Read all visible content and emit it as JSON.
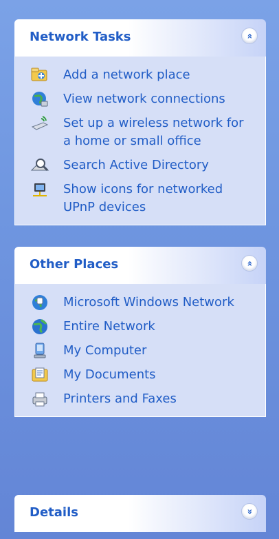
{
  "network_tasks": {
    "title": "Network Tasks",
    "collapse_glyph": "«",
    "items": [
      {
        "label": "Add a network place",
        "icon": "add-network-place-icon"
      },
      {
        "label": "View network connections",
        "icon": "network-connections-icon"
      },
      {
        "label": "Set up a wireless network for a home or small office",
        "icon": "wireless-network-icon"
      },
      {
        "label": "Search Active Directory",
        "icon": "search-directory-icon"
      },
      {
        "label": "Show icons for networked UPnP devices",
        "icon": "upnp-devices-icon"
      }
    ]
  },
  "other_places": {
    "title": "Other Places",
    "collapse_glyph": "«",
    "items": [
      {
        "label": "Microsoft Windows Network",
        "icon": "windows-network-icon"
      },
      {
        "label": "Entire Network",
        "icon": "entire-network-icon"
      },
      {
        "label": "My Computer",
        "icon": "my-computer-icon"
      },
      {
        "label": "My Documents",
        "icon": "my-documents-icon"
      },
      {
        "label": "Printers and Faxes",
        "icon": "printers-faxes-icon"
      }
    ]
  },
  "details": {
    "title": "Details",
    "expand_glyph": "»"
  },
  "colors": {
    "link": "#215dc6",
    "pane_body": "#d6dff7",
    "background": "#6f96e0"
  }
}
